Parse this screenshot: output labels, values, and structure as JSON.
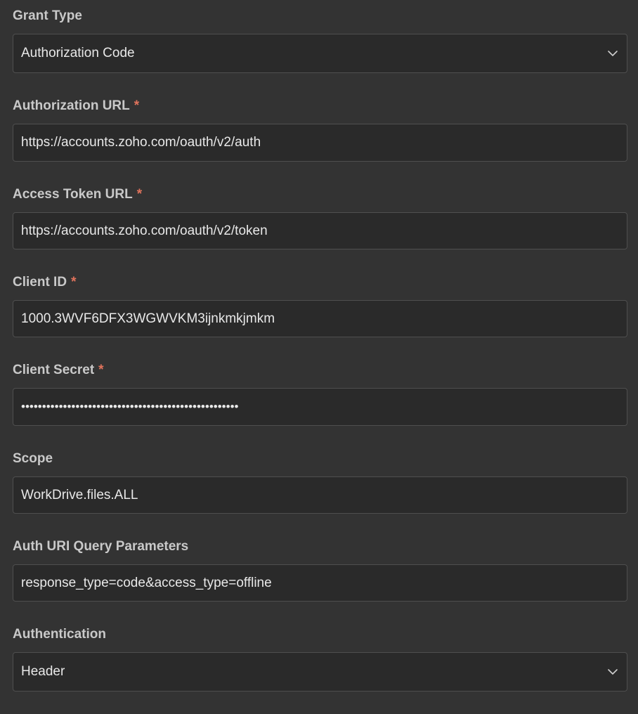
{
  "grant_type": {
    "label": "Grant Type",
    "value": "Authorization Code"
  },
  "authorization_url": {
    "label": "Authorization URL",
    "required_mark": "*",
    "value": "https://accounts.zoho.com/oauth/v2/auth"
  },
  "access_token_url": {
    "label": "Access Token URL",
    "required_mark": "*",
    "value": "https://accounts.zoho.com/oauth/v2/token"
  },
  "client_id": {
    "label": "Client ID",
    "required_mark": "*",
    "value": "1000.3WVF6DFX3WGWVKM3ijnkmkjmkm"
  },
  "client_secret": {
    "label": "Client Secret",
    "required_mark": "*",
    "value": "••••••••••••••••••••••••••••••••••••••••••••••••••••"
  },
  "scope": {
    "label": "Scope",
    "value": "WorkDrive.files.ALL"
  },
  "auth_uri_query_parameters": {
    "label": "Auth URI Query Parameters",
    "value": "response_type=code&access_type=offline"
  },
  "authentication": {
    "label": "Authentication",
    "value": "Header"
  },
  "icons": {
    "dropdown": "chevron-down-icon"
  },
  "colors": {
    "background": "#333333",
    "field_background": "#2a2a2a",
    "field_border": "#4f4f4f",
    "label": "#c9c9c9",
    "value": "#e8e8e8",
    "required": "#e0735c"
  }
}
